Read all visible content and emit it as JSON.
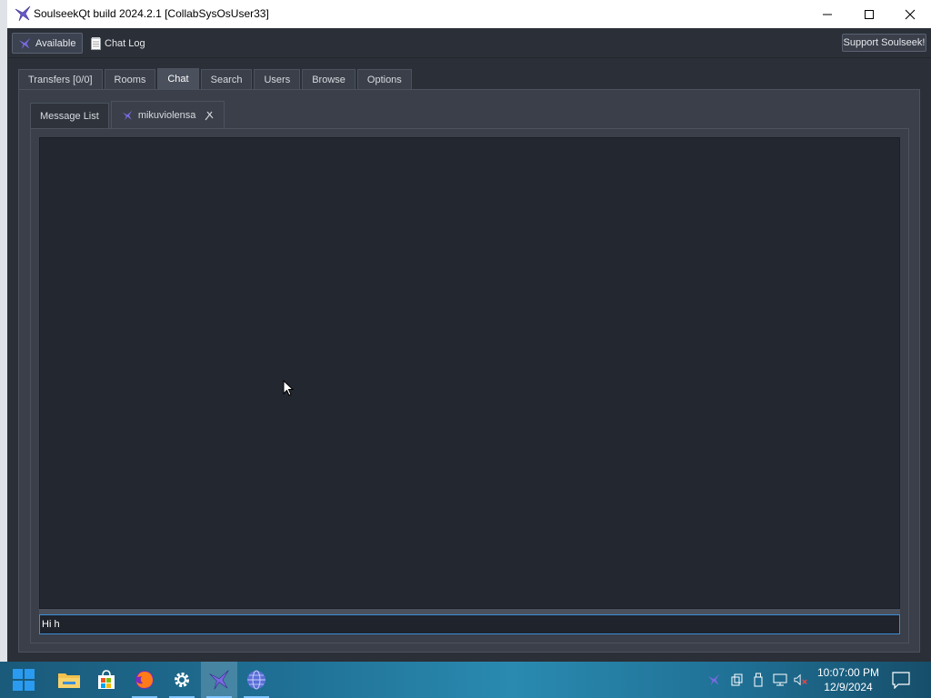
{
  "window": {
    "title": "SoulseekQt build 2024.2.1 [CollabSysOsUser33]"
  },
  "toolbar": {
    "status_label": "Available",
    "chat_log_label": "Chat Log",
    "support_label": "Support Soulseek!"
  },
  "main_tabs": [
    {
      "label": "Transfers [0/0]",
      "active": false
    },
    {
      "label": "Rooms",
      "active": false
    },
    {
      "label": "Chat",
      "active": true
    },
    {
      "label": "Search",
      "active": false
    },
    {
      "label": "Users",
      "active": false
    },
    {
      "label": "Browse",
      "active": false
    },
    {
      "label": "Options",
      "active": false
    }
  ],
  "chat_tabs": {
    "message_list_label": "Message List",
    "user_tab_label": "mikuviolensa"
  },
  "chat": {
    "input_value": "Hi h"
  },
  "taskbar": {
    "clock_time": "10:07:00 PM",
    "clock_date": "12/9/2024"
  },
  "colors": {
    "accent": "#3b8ed8",
    "window_bg": "#2b2f37",
    "chat_bg": "#232730",
    "soulseek_bird": "#6a5acd"
  }
}
